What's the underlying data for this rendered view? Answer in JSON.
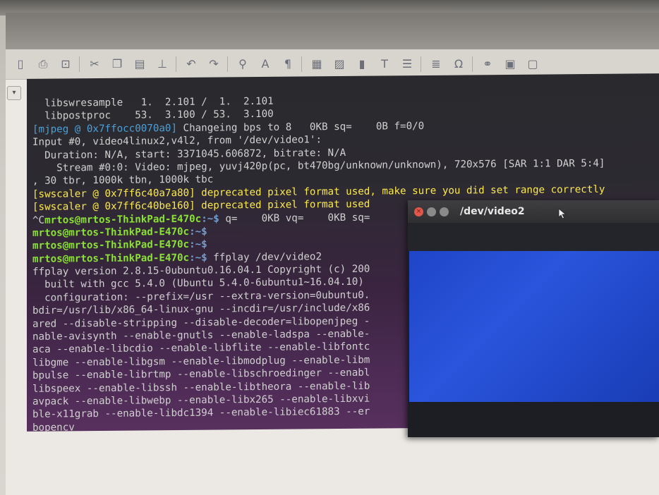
{
  "terminal": {
    "lines": [
      {
        "type": "plain",
        "text": "  libswresample   1.  2.101 /  1.  2.101"
      },
      {
        "type": "plain",
        "text": "  libpostproc    53.  3.100 / 53.  3.100"
      },
      {
        "type": "tagged",
        "tag": "[mjpeg @ 0x7ffocc0070a0]",
        "text": " Changeing bps to 8   0KB sq=    0B f=0/0"
      },
      {
        "type": "plain",
        "text": "Input #0, video4linux2,v4l2, from '/dev/video1':"
      },
      {
        "type": "plain",
        "text": "  Duration: N/A, start: 3371045.606872, bitrate: N/A"
      },
      {
        "type": "plain",
        "text": "    Stream #0:0: Video: mjpeg, yuvj420p(pc, bt470bg/unknown/unknown), 720x576 [SAR 1:1 DAR 5:4]"
      },
      {
        "type": "plain",
        "text": ", 30 tbr, 1000k tbn, 1000k tbc"
      },
      {
        "type": "warn",
        "tag": "[swscaler @ 0x7ff6c40a7a80]",
        "text": " deprecated pixel format used, make sure you did set range correctly"
      },
      {
        "type": "warn",
        "tag": "[swscaler @ 0x7ff6c40be160]",
        "text": " deprecated pixel format used"
      },
      {
        "type": "prompt",
        "pre": "^C",
        "user": "mrtos@mrtos-ThinkPad-E470c",
        "path": ":~$",
        "text": " q=    0KB vq=    0KB sq="
      },
      {
        "type": "prompt",
        "pre": "",
        "user": "mrtos@mrtos-ThinkPad-E470c",
        "path": ":~$",
        "text": ""
      },
      {
        "type": "prompt",
        "pre": "",
        "user": "mrtos@mrtos-ThinkPad-E470c",
        "path": ":~$",
        "text": ""
      },
      {
        "type": "prompt",
        "pre": "",
        "user": "mrtos@mrtos-ThinkPad-E470c",
        "path": ":~$",
        "text": " ffplay /dev/video2"
      },
      {
        "type": "plain",
        "text": "ffplay version 2.8.15-0ubuntu0.16.04.1 Copyright (c) 200"
      },
      {
        "type": "plain",
        "text": "  built with gcc 5.4.0 (Ubuntu 5.4.0-6ubuntu1~16.04.10)"
      },
      {
        "type": "plain",
        "text": "  configuration: --prefix=/usr --extra-version=0ubuntu0."
      },
      {
        "type": "plain",
        "text": "bdir=/usr/lib/x86_64-linux-gnu --incdir=/usr/include/x86"
      },
      {
        "type": "plain",
        "text": "ared --disable-stripping --disable-decoder=libopenjpeg -"
      },
      {
        "type": "plain",
        "text": "nable-avisynth --enable-gnutls --enable-ladspa --enable-"
      },
      {
        "type": "plain",
        "text": "aca --enable-libcdio --enable-libflite --enable-libfontc"
      },
      {
        "type": "plain",
        "text": "libgme --enable-libgsm --enable-libmodplug --enable-libm"
      },
      {
        "type": "plain",
        "text": "bpulse --enable-librtmp --enable-libschroedinger --enabl"
      },
      {
        "type": "plain",
        "text": "libspeex --enable-libssh --enable-libtheora --enable-lib"
      },
      {
        "type": "plain",
        "text": "avpack --enable-libwebp --enable-libx265 --enable-libxvi"
      },
      {
        "type": "plain",
        "text": "ble-x11grab --enable-libdc1394 --enable-libiec61883 --er"
      },
      {
        "type": "plain",
        "text": "bopencv"
      }
    ]
  },
  "video_window": {
    "title": "/dev/video2",
    "frame_color": "#2a55dc"
  },
  "toolbar": {
    "icons": [
      {
        "name": "page-icon",
        "glyph": "▯"
      },
      {
        "name": "print-icon",
        "glyph": "⎙"
      },
      {
        "name": "print-preview-icon",
        "glyph": "⊡"
      },
      {
        "name": "cut-icon",
        "glyph": "✂"
      },
      {
        "name": "copy-icon",
        "glyph": "❐"
      },
      {
        "name": "paste-icon",
        "glyph": "▤"
      },
      {
        "name": "clone-icon",
        "glyph": "⊥"
      },
      {
        "name": "undo-icon",
        "glyph": "↶"
      },
      {
        "name": "redo-icon",
        "glyph": "↷"
      },
      {
        "name": "find-icon",
        "glyph": "⚲"
      },
      {
        "name": "spelling-icon",
        "glyph": "A"
      },
      {
        "name": "formatting-marks-icon",
        "glyph": "¶"
      },
      {
        "name": "table-icon",
        "glyph": "▦"
      },
      {
        "name": "image-icon",
        "glyph": "▨"
      },
      {
        "name": "chart-icon",
        "glyph": "▮"
      },
      {
        "name": "textbox-icon",
        "glyph": "T"
      },
      {
        "name": "header-icon",
        "glyph": "☰"
      },
      {
        "name": "field-icon",
        "glyph": "≣"
      },
      {
        "name": "special-char-icon",
        "glyph": "Ω"
      },
      {
        "name": "hyperlink-icon",
        "glyph": "⚭"
      },
      {
        "name": "footnote-icon",
        "glyph": "▣"
      },
      {
        "name": "comment-icon",
        "glyph": "▢"
      }
    ]
  },
  "colors": {
    "prompt_green": "#8ae234",
    "path_blue": "#729fcf",
    "warning_yellow": "#fce94f",
    "close_red": "#e2574c"
  }
}
